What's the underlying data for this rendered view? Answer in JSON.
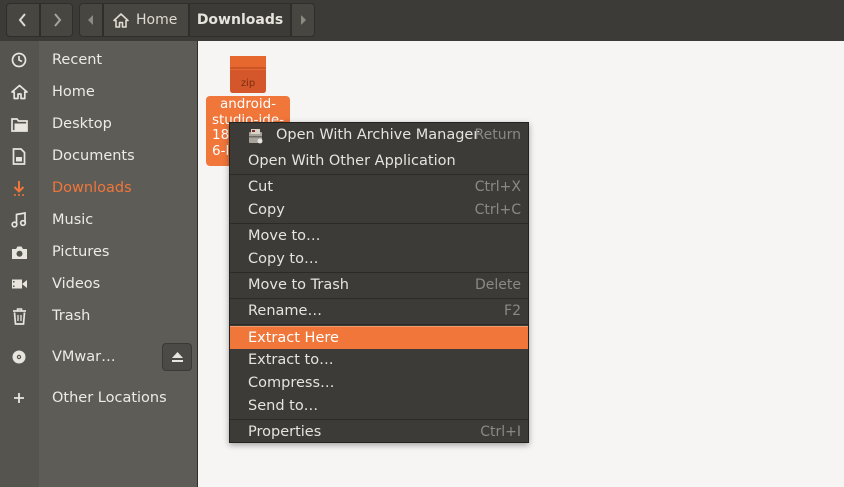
{
  "header": {
    "back_icon": "chevron-left-icon",
    "forward_icon": "chevron-right-icon",
    "path": {
      "home": "Home",
      "current": "Downloads"
    }
  },
  "sidebar": {
    "items": [
      {
        "label": "Recent",
        "icon": "clock-icon"
      },
      {
        "label": "Home",
        "icon": "home-icon"
      },
      {
        "label": "Desktop",
        "icon": "folder-icon"
      },
      {
        "label": "Documents",
        "icon": "document-icon"
      },
      {
        "label": "Downloads",
        "icon": "download-icon"
      },
      {
        "label": "Music",
        "icon": "music-icon"
      },
      {
        "label": "Pictures",
        "icon": "camera-icon"
      },
      {
        "label": "Videos",
        "icon": "video-icon"
      },
      {
        "label": "Trash",
        "icon": "trash-icon"
      },
      {
        "label": "VMwar…",
        "icon": "disc-icon"
      },
      {
        "label": "Other Locations",
        "icon": "plus-icon"
      }
    ],
    "active": "Downloads"
  },
  "file": {
    "icon_text": "zip",
    "label_lines": [
      "android-",
      "studio-ide-",
      "18",
      "6-l"
    ]
  },
  "context_menu": {
    "items": [
      {
        "label": "Open With Archive Manager",
        "shortcut": "Return"
      },
      {
        "label": "Open With Other Application",
        "shortcut": ""
      },
      {
        "label": "Cut",
        "shortcut": "Ctrl+X"
      },
      {
        "label": "Copy",
        "shortcut": "Ctrl+C"
      },
      {
        "label": "Move to…",
        "shortcut": ""
      },
      {
        "label": "Copy to…",
        "shortcut": ""
      },
      {
        "label": "Move to Trash",
        "shortcut": "Delete"
      },
      {
        "label": "Rename…",
        "shortcut": "F2"
      },
      {
        "label": "Extract Here",
        "shortcut": ""
      },
      {
        "label": "Extract to…",
        "shortcut": ""
      },
      {
        "label": "Compress…",
        "shortcut": ""
      },
      {
        "label": "Send to…",
        "shortcut": ""
      },
      {
        "label": "Properties",
        "shortcut": "Ctrl+I"
      }
    ],
    "highlighted": "Extract Here"
  },
  "colors": {
    "accent": "#f0763a",
    "header_bg": "#3c3b37",
    "sidebar_bg": "#5e5c57",
    "menu_bg": "#3c3b37"
  }
}
